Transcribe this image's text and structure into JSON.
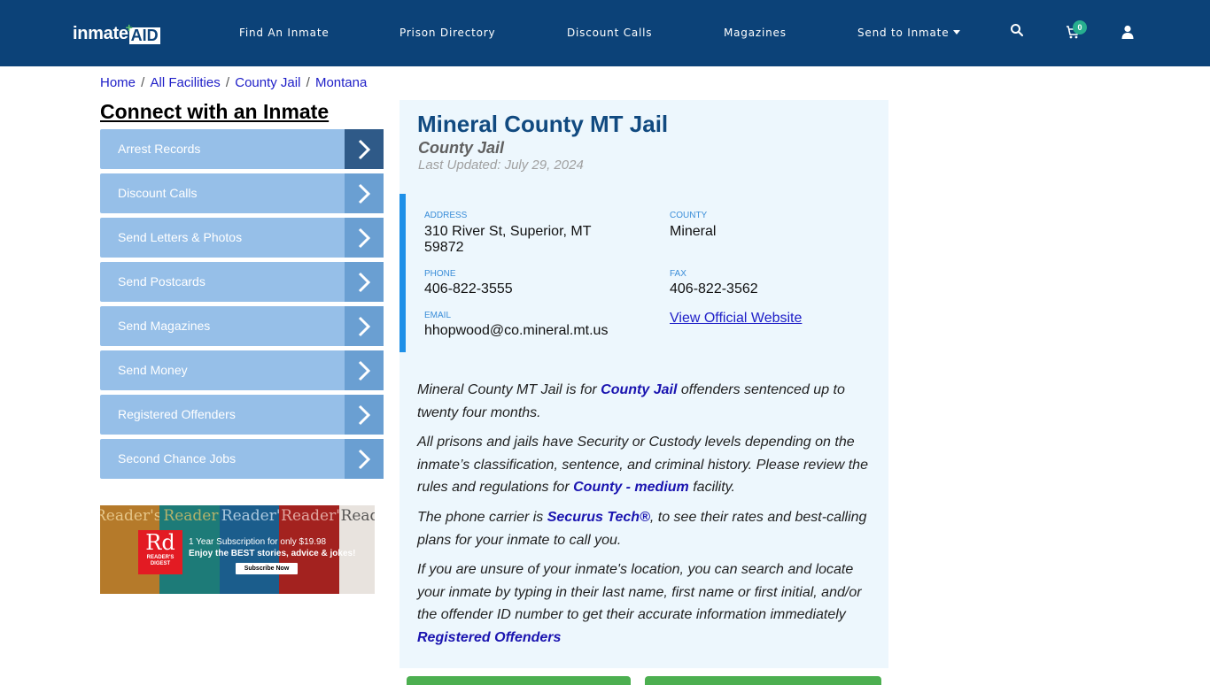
{
  "header": {
    "logo": {
      "part1": "inmate",
      "part2": "AID"
    },
    "nav": [
      {
        "label": "Find An Inmate"
      },
      {
        "label": "Prison Directory"
      },
      {
        "label": "Discount Calls"
      },
      {
        "label": "Magazines"
      },
      {
        "label": "Send to Inmate",
        "has_dropdown": true
      }
    ],
    "icons": [
      "search-icon",
      "cart-icon",
      "user-icon"
    ],
    "cart_count": "0",
    "colors": {
      "bar": "#0c4278",
      "badge": "#27ae8f"
    }
  },
  "breadcrumb": [
    {
      "label": "Home"
    },
    {
      "label": "All Facilities"
    },
    {
      "label": "County Jail"
    },
    {
      "label": "Montana"
    }
  ],
  "sidebar": {
    "title": "Connect with an Inmate",
    "items": [
      {
        "label": "Arrest Records",
        "active": true
      },
      {
        "label": "Discount Calls"
      },
      {
        "label": "Send Letters & Photos"
      },
      {
        "label": "Send Postcards"
      },
      {
        "label": "Send Magazines"
      },
      {
        "label": "Send Money"
      },
      {
        "label": "Registered Offenders"
      },
      {
        "label": "Second Chance Jobs"
      }
    ],
    "ad": {
      "brand_short": "Rd",
      "brand_line1": "READER'S",
      "brand_line2": "DIGEST",
      "masthead": "Reader's",
      "line1": "1 Year Subscription for only $19.98",
      "line2": "Enjoy the BEST stories, advice & jokes!",
      "cta": "Subscribe Now"
    }
  },
  "facility": {
    "name": "Mineral County MT Jail",
    "type": "County Jail",
    "last_updated": "Last Updated: July 29, 2024",
    "address_label": "ADDRESS",
    "address_line1": "310 River St, Superior, MT",
    "address_line2": "59872",
    "county_label": "COUNTY",
    "county": "Mineral",
    "phone_label": "PHONE",
    "phone": "406-822-3555",
    "fax_label": "FAX",
    "fax": "406-822-3562",
    "email_label": "EMAIL",
    "email": "hhopwood@co.mineral.mt.us",
    "website_link": "View Official Website"
  },
  "description": {
    "p1": {
      "pre": "Mineral County MT Jail is for ",
      "link": "County Jail",
      "post": " offenders sentenced up to twenty four months."
    },
    "p2": {
      "pre": "All prisons and jails have Security or Custody levels depending on the inmate’s classification, sentence, and criminal history. Please review the rules and regulations for ",
      "link": "County - medium",
      "post": " facility."
    },
    "p3": {
      "pre": "The phone carrier is ",
      "link": "Securus Tech®",
      "post": ", to see their rates and best-calling plans for your inmate to call you."
    },
    "p4": {
      "pre": "If you are unsure of your inmate's location, you can search and locate your inmate by typing in their last name, first name or first initial, and/or the offender ID number to get their accurate information immediately",
      "link": "Registered Offenders"
    }
  }
}
